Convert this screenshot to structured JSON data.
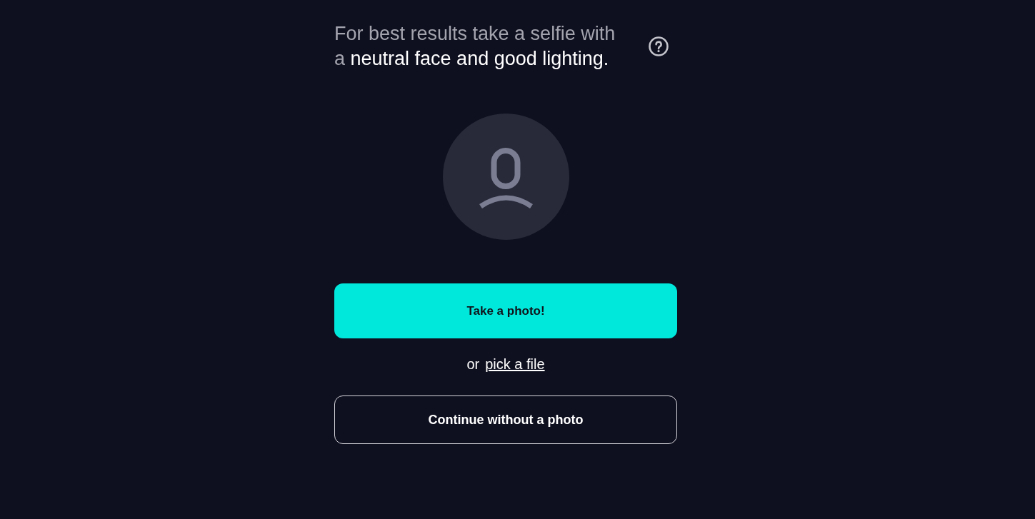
{
  "hint": {
    "text": "For best results take a selfie with a",
    "highlight": "neutral face and good lighting."
  },
  "primary_button": {
    "label": "Take a photo!"
  },
  "file_option": {
    "prefix": "or",
    "link": "pick a file"
  },
  "secondary_button": {
    "label": "Continue without a photo"
  }
}
